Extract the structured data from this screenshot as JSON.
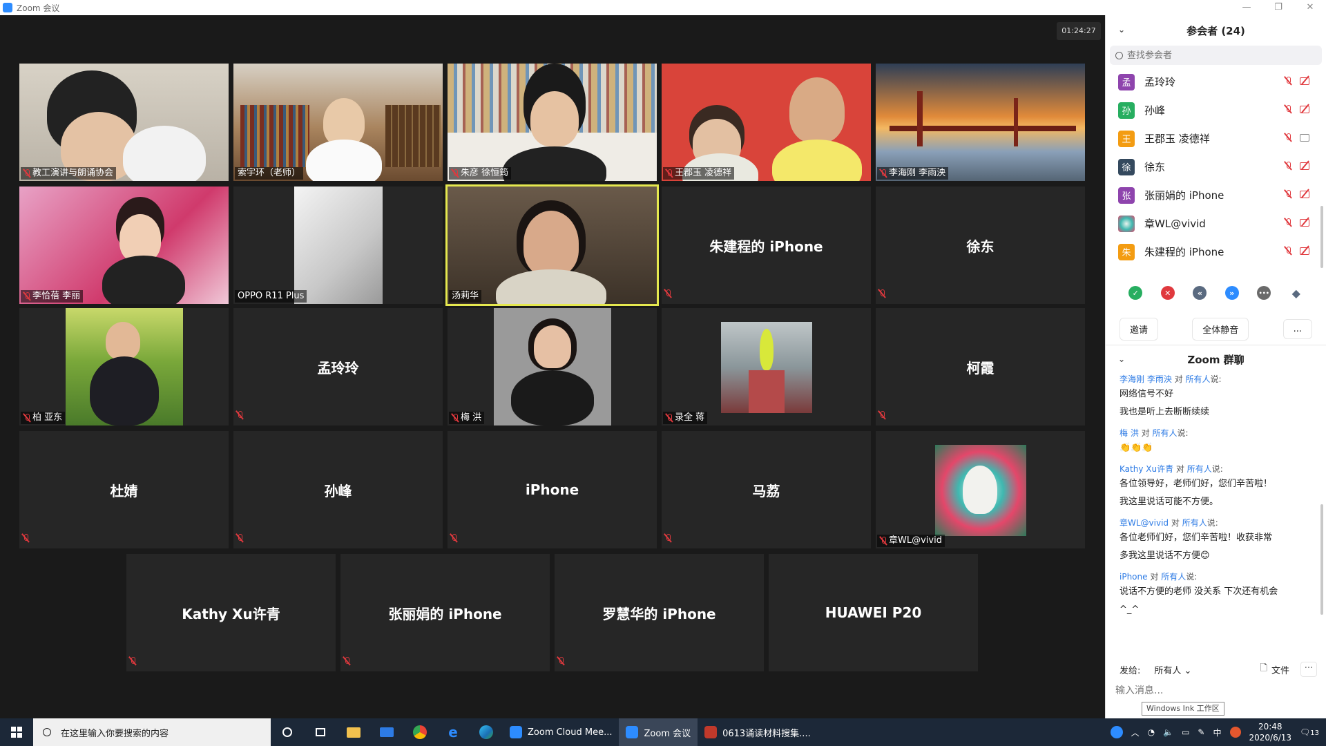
{
  "window": {
    "title": "Zoom 会议",
    "minimize": "—",
    "restore": "❐",
    "close": "✕"
  },
  "timer": "01:24:27",
  "tiles": [
    {
      "name": "教工演讲与朗诵协会"
    },
    {
      "name": "索宇环（老师）"
    },
    {
      "name": "朱彦 徐恒筠"
    },
    {
      "name": "王郡玉 凌德祥"
    },
    {
      "name": "李海刚 李雨泱"
    },
    {
      "name": "李恰蓓 李丽"
    },
    {
      "name": "OPPO R11 Plus"
    },
    {
      "name": "汤莉华"
    },
    {
      "name": "朱建程的 iPhone"
    },
    {
      "name": "徐东"
    },
    {
      "name": "柏 亚东"
    },
    {
      "name": "孟玲玲"
    },
    {
      "name": "梅 洪"
    },
    {
      "name": "录全 蒋"
    },
    {
      "name": "柯霞"
    },
    {
      "name": "杜婧"
    },
    {
      "name": "孙峰"
    },
    {
      "name": "iPhone"
    },
    {
      "name": "马荔"
    },
    {
      "name": "章WL@vivid"
    },
    {
      "name": "Kathy Xu许青"
    },
    {
      "name": "张丽娟的 iPhone"
    },
    {
      "name": "罗慧华的 iPhone"
    },
    {
      "name": "HUAWEI P20"
    }
  ],
  "participants": {
    "title": "参会者 (24)",
    "search_placeholder": "查找参会者",
    "list": [
      {
        "avatar": "孟",
        "name": "孟玲玲",
        "color": "#8e44ad"
      },
      {
        "avatar": "孙",
        "name": "孙峰",
        "color": "#27ae60"
      },
      {
        "avatar": "王",
        "name": "王郡玉 凌德祥",
        "color": "#f39c12"
      },
      {
        "avatar": "徐",
        "name": "徐东",
        "color": "#34495e"
      },
      {
        "avatar": "张",
        "name": "张丽娟的 iPhone",
        "color": "#8e44ad"
      },
      {
        "avatar": "",
        "name": "章WL@vivid",
        "color": "#7fb3c8"
      },
      {
        "avatar": "朱",
        "name": "朱建程的 iPhone",
        "color": "#f39c12"
      }
    ],
    "reactions": [
      "✓",
      "✕",
      "«",
      "»",
      "•••",
      "◆"
    ],
    "invite": "邀请",
    "mute_all": "全体静音",
    "more": "..."
  },
  "chat": {
    "title": "Zoom 群聊",
    "messages": [
      {
        "from": "李海刚 李雨泱",
        "to": "所有人",
        "lines": [
          "网络信号不好",
          "我也是听上去断断续续"
        ]
      },
      {
        "from": "梅 洪",
        "to": "所有人",
        "lines": [
          "👏👏👏"
        ]
      },
      {
        "from": "Kathy Xu许青",
        "to": "所有人",
        "lines": [
          "各位领导好，老师们好，您们辛苦啦！",
          "我这里说话可能不方便。"
        ]
      },
      {
        "from": "章WL@vivid",
        "to": "所有人",
        "lines": [
          "各位老师们好，您们辛苦啦！收获非常",
          "多我这里说话不方便😊"
        ]
      },
      {
        "from": "iPhone",
        "to": "所有人",
        "lines": [
          "说话不方便的老师 没关系 下次还有机会",
          "^_^"
        ]
      }
    ],
    "pair_text": "对",
    "said": "说:",
    "send_to_label": "发给:",
    "send_to_value": "所有人",
    "file_label": "文件",
    "more": "···",
    "input_placeholder": "输入消息...",
    "ink_tip": "Windows Ink 工作区"
  },
  "taskbar": {
    "search_placeholder": "在这里输入你要搜索的内容",
    "apps": [
      {
        "label": "Zoom Cloud Mee...",
        "color": "#2d8cff"
      },
      {
        "label": "Zoom 会议",
        "color": "#2d8cff"
      },
      {
        "label": "0613诵读材料搜集....",
        "color": "#c0392b"
      }
    ],
    "ime": "中",
    "time": "20:48",
    "date": "2020/6/13",
    "notif": "13"
  }
}
